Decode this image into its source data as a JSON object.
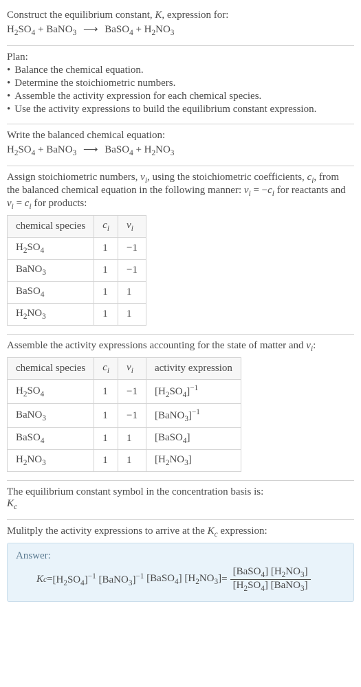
{
  "intro": {
    "line1": "Construct the equilibrium constant, ",
    "k": "K",
    "line1b": ", expression for:",
    "eq_lhs_a": "H",
    "eq_lhs_a_sub": "2",
    "eq_lhs_a2": "SO",
    "eq_lhs_a2_sub": "4",
    "plus": " + ",
    "eq_lhs_b": "BaNO",
    "eq_lhs_b_sub": "3",
    "arrow": "⟶",
    "eq_rhs_a": "BaSO",
    "eq_rhs_a_sub": "4",
    "eq_rhs_b": "H",
    "eq_rhs_b2": "2",
    "eq_rhs_b3": "NO",
    "eq_rhs_b3_sub": "3"
  },
  "plan": {
    "heading": "Plan:",
    "items": [
      "Balance the chemical equation.",
      "Determine the stoichiometric numbers.",
      "Assemble the activity expression for each chemical species.",
      "Use the activity expressions to build the equilibrium constant expression."
    ]
  },
  "balanced_heading": "Write the balanced chemical equation:",
  "assign": {
    "text_a": "Assign stoichiometric numbers, ",
    "nu": "ν",
    "sub_i": "i",
    "text_b": ", using the stoichiometric coefficients, ",
    "c": "c",
    "text_c": ", from the balanced chemical equation in the following manner: ",
    "eq1_lhs": "ν",
    "eq1_eq": " = −",
    "eq1_rhs": "c",
    "text_d": " for reactants and ",
    "eq2_mid": " = ",
    "text_e": " for products:"
  },
  "table1": {
    "headers": [
      "chemical species",
      "cᵢ",
      "νᵢ"
    ],
    "rows": [
      {
        "species_html": "H<span class='sub'>2</span>SO<span class='sub'>4</span>",
        "c": "1",
        "nu": "−1"
      },
      {
        "species_html": "BaNO<span class='sub'>3</span>",
        "c": "1",
        "nu": "−1"
      },
      {
        "species_html": "BaSO<span class='sub'>4</span>",
        "c": "1",
        "nu": "1"
      },
      {
        "species_html": "H<span class='sub'>2</span>NO<span class='sub'>3</span>",
        "c": "1",
        "nu": "1"
      }
    ]
  },
  "activity_heading_a": "Assemble the activity expressions accounting for the state of matter and ",
  "activity_heading_b": ":",
  "table2": {
    "headers": [
      "chemical species",
      "cᵢ",
      "νᵢ",
      "activity expression"
    ],
    "rows": [
      {
        "species_html": "H<span class='sub'>2</span>SO<span class='sub'>4</span>",
        "c": "1",
        "nu": "−1",
        "act_html": "[H<span class='sub'>2</span>SO<span class='sub'>4</span>]<span class='sup'>−1</span>"
      },
      {
        "species_html": "BaNO<span class='sub'>3</span>",
        "c": "1",
        "nu": "−1",
        "act_html": "[BaNO<span class='sub'>3</span>]<span class='sup'>−1</span>"
      },
      {
        "species_html": "BaSO<span class='sub'>4</span>",
        "c": "1",
        "nu": "1",
        "act_html": "[BaSO<span class='sub'>4</span>]"
      },
      {
        "species_html": "H<span class='sub'>2</span>NO<span class='sub'>3</span>",
        "c": "1",
        "nu": "1",
        "act_html": "[H<span class='sub'>2</span>NO<span class='sub'>3</span>]"
      }
    ]
  },
  "symbol_line": "The equilibrium constant symbol in the concentration basis is:",
  "kc_big": "K",
  "kc_sub": "c",
  "multiply_line_a": "Mulitply the activity expressions to arrive at the ",
  "multiply_line_b": " expression:",
  "answer": {
    "label": "Answer:",
    "kc": "K",
    "kc_sub": "c",
    "eq": " = ",
    "term1": "[H<span class='sub'>2</span>SO<span class='sub'>4</span>]<span class='sup'>−1</span>",
    "term2": "[BaNO<span class='sub'>3</span>]<span class='sup'>−1</span>",
    "term3": "[BaSO<span class='sub'>4</span>]",
    "term4": "[H<span class='sub'>2</span>NO<span class='sub'>3</span>]",
    "frac_num": "[BaSO<span class='sub'>4</span>] [H<span class='sub'>2</span>NO<span class='sub'>3</span>]",
    "frac_den": "[H<span class='sub'>2</span>SO<span class='sub'>4</span>] [BaNO<span class='sub'>3</span>]"
  }
}
